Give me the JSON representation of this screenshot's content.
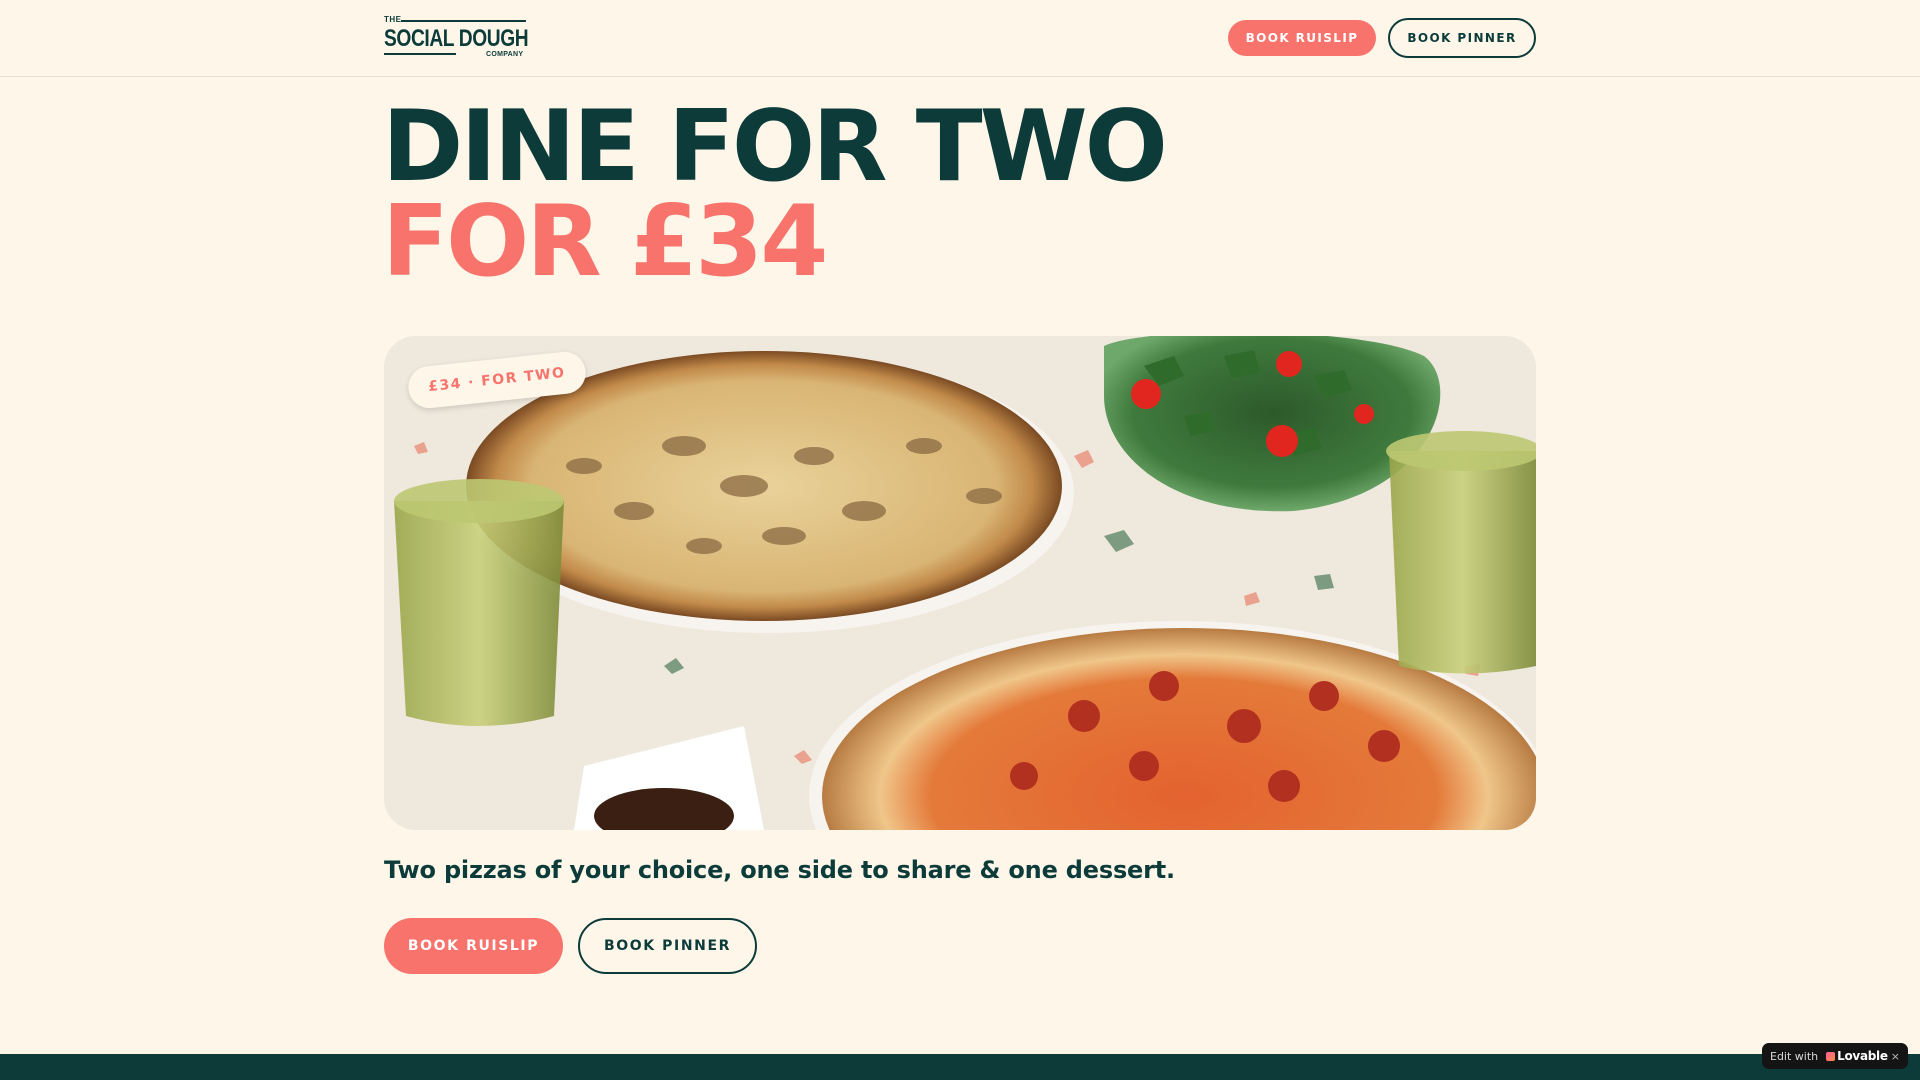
{
  "brand": {
    "the": "THE",
    "name": "SOCIAL DOUGH",
    "company": "COMPANY"
  },
  "header": {
    "book_ruislip": "BOOK RUISLIP",
    "book_pinner": "BOOK PINNER"
  },
  "hero": {
    "headline_line1": "DINE FOR TWO",
    "headline_line2": "FOR £34",
    "price_tag": "£34 · FOR TWO",
    "image_subject": "two pizzas, salad and drinks on terrazzo table"
  },
  "offer": {
    "description": "Two pizzas of your choice, one side to share & one dessert."
  },
  "cta": {
    "book_ruislip": "BOOK RUISLIP",
    "book_pinner": "BOOK PINNER"
  },
  "badge": {
    "edit_with": "Edit with",
    "brand": "Lovable",
    "close": "×"
  },
  "colors": {
    "background": "#fdf6e9",
    "primary_dark": "#0c3b3a",
    "accent_coral": "#f7736b"
  },
  "icons": [
    "lovable-logo-icon",
    "close-icon"
  ]
}
